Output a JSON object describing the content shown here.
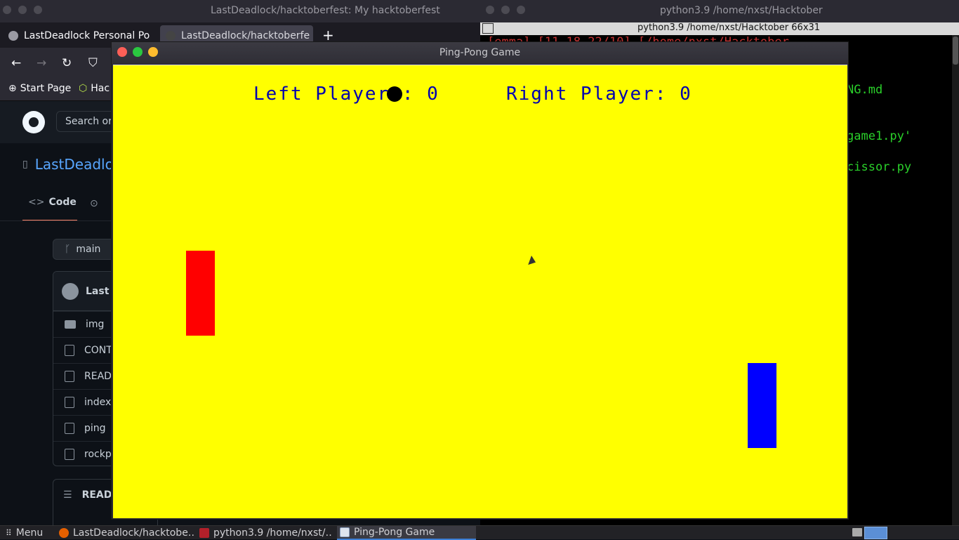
{
  "browser": {
    "window_title": "LastDeadlock/hacktoberfest: My hacktoberfest",
    "tabs": [
      {
        "label": "LastDeadlock Personal Po"
      },
      {
        "label": "LastDeadlock/hacktoberfe"
      }
    ],
    "bookmarks": [
      {
        "label": "Start Page"
      },
      {
        "label": "Hac"
      }
    ],
    "github": {
      "search_placeholder": "Search or",
      "repo_name": "LastDeadlo",
      "code_tab_label": "Code",
      "branch": "main",
      "commit_author": "Last",
      "files": [
        {
          "name": "img",
          "type": "dir"
        },
        {
          "name": "CONT",
          "type": "file"
        },
        {
          "name": "READ",
          "type": "file"
        },
        {
          "name": "index",
          "type": "file"
        },
        {
          "name": "ping",
          "type": "file"
        },
        {
          "name": "rockp",
          "type": "file"
        }
      ],
      "readme_label": "READ"
    }
  },
  "terminal": {
    "window_title": "python3.9 /home/nxst/Hacktober",
    "tab_title": "python3.9 /home/nxst/Hacktober 66x31",
    "lines": [
      {
        "text": "[emma] [11-18-22/10] [/home/nxst/Hacktober"
      },
      {
        "text": "NG.md"
      },
      {
        "text": "game1.py'"
      },
      {
        "text": "cissor.py"
      }
    ]
  },
  "game": {
    "window_title": "Ping-Pong Game",
    "left_score_text": "Left Player : 0",
    "right_score_text": "Right Player: 0",
    "left_score": 0,
    "right_score": 0,
    "colors": {
      "background": "#ffff00",
      "score_text": "#0000b0",
      "ball": "#000000",
      "left_paddle": "#ff0000",
      "right_paddle": "#0000ff"
    }
  },
  "taskbar": {
    "menu_label": "Menu",
    "items": [
      {
        "label": "LastDeadlock/hacktobe…"
      },
      {
        "label": "python3.9 /home/nxst/…"
      },
      {
        "label": "Ping-Pong Game"
      }
    ]
  }
}
